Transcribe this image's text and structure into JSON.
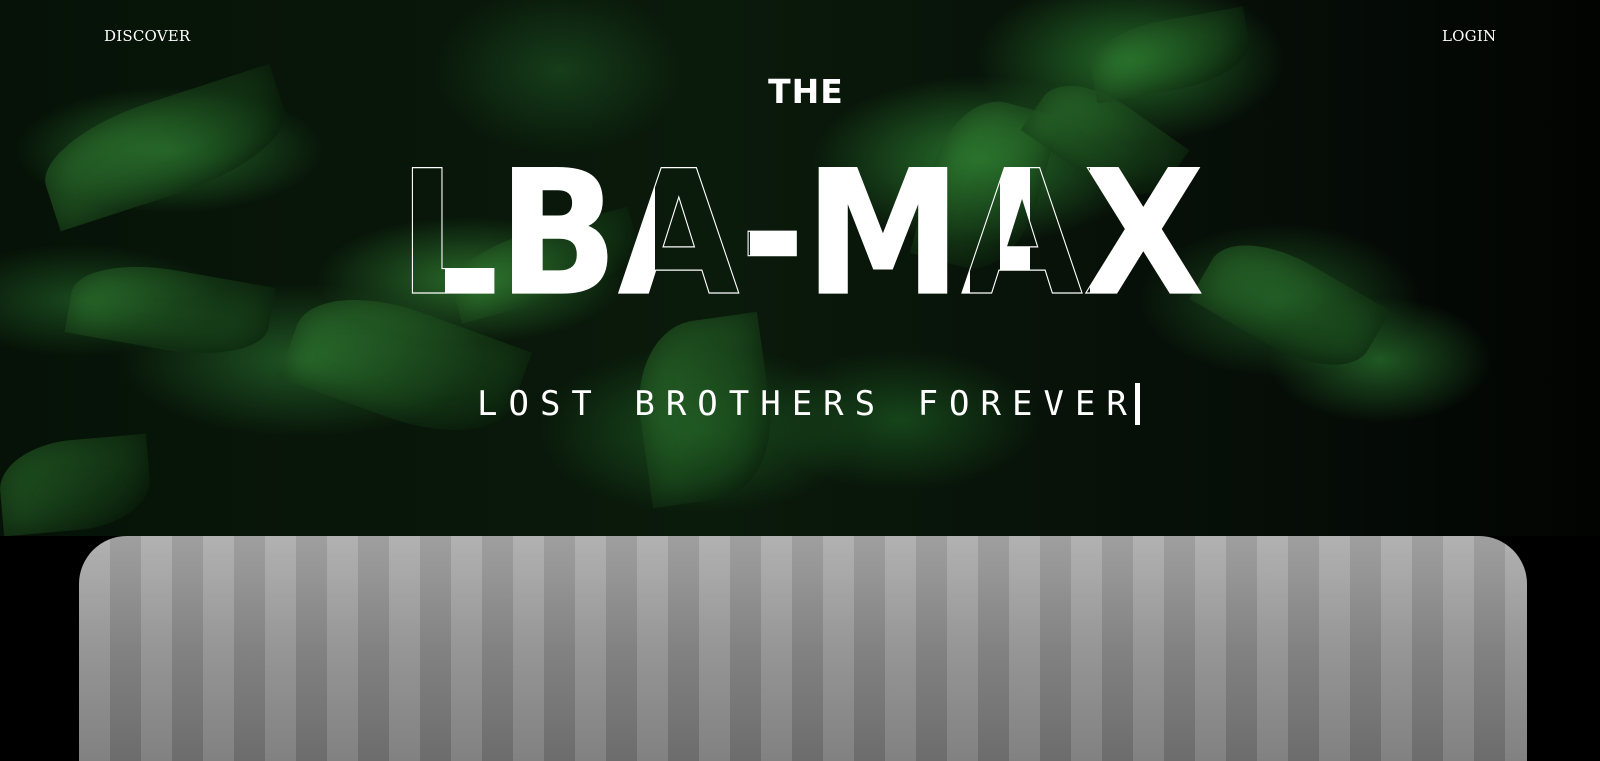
{
  "nav": {
    "left_label": "DISCOVER",
    "right_label": "LOGIN"
  },
  "hero": {
    "pre_title": "THE",
    "title": "LBA-MAX",
    "tagline": "LOST BROTHERS FOREVER",
    "background_image": "green leaves with water droplets"
  },
  "colors": {
    "text": "#ffffff",
    "page_background": "#000000",
    "panel": "#8c8c8c"
  }
}
